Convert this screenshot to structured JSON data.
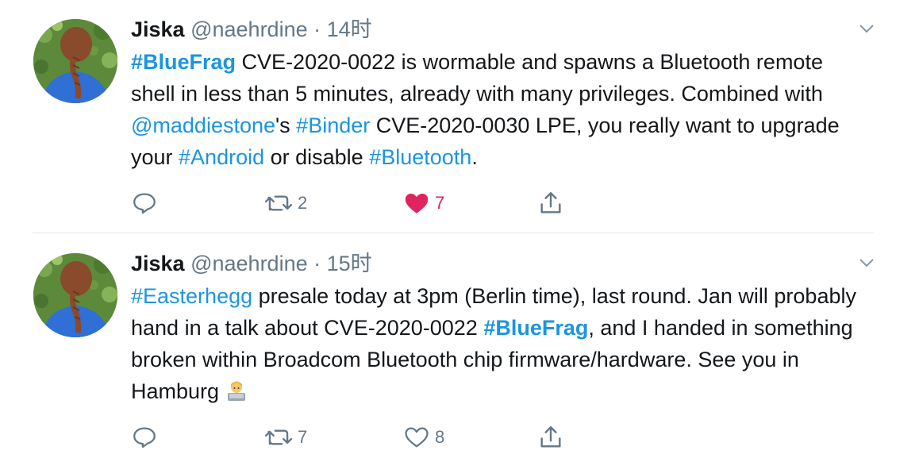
{
  "tweets": [
    {
      "name": "Jiska",
      "handle": "@naehrdine",
      "dot": "·",
      "time": "14时",
      "text": {
        "s1": "#BlueFrag",
        "s2": " CVE-2020-0022 is wormable and spawns a Bluetooth remote shell in less than 5 minutes, already with many privileges. Combined with ",
        "s3": "@maddiestone",
        "s4": "'s ",
        "s5": "#Binder",
        "s6": " CVE-2020-0030 LPE, you really want to upgrade your ",
        "s7": "#Android",
        "s8": " or disable ",
        "s9": "#Bluetooth",
        "s10": "."
      },
      "retweets": "2",
      "likes": "7",
      "liked": true
    },
    {
      "name": "Jiska",
      "handle": "@naehrdine",
      "dot": "·",
      "time": "15时",
      "text": {
        "s1": "#Easterhegg",
        "s2": " presale today at 3pm (Berlin time), last round. Jan will probably hand in a talk about CVE-2020-0022 ",
        "s3": "#BlueFrag",
        "s4": ", and I handed in something broken within Broadcom Bluetooth chip firmware/hardware. See you in Hamburg "
      },
      "emoji": "technologist-emoji",
      "retweets": "7",
      "likes": "8",
      "liked": false
    }
  ],
  "colors": {
    "link": "#1b95e0",
    "secondary": "#657786",
    "like_active": "#e0245e",
    "divider": "#e1e8ed"
  },
  "icons": [
    "reply-icon",
    "retweet-icon",
    "like-icon",
    "share-icon",
    "chevron-down-icon"
  ]
}
